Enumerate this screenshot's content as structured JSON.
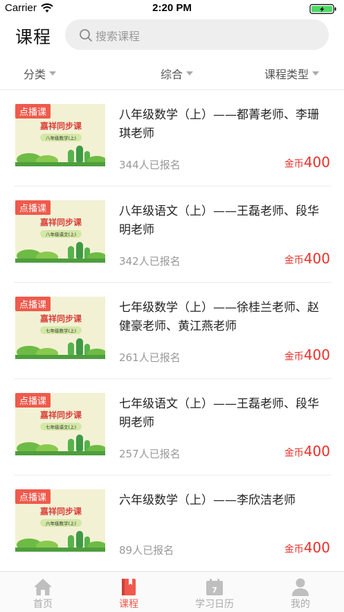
{
  "status_bar": {
    "carrier": "Carrier",
    "time": "2:20 PM"
  },
  "header": {
    "title": "课程",
    "search_placeholder": "搜索课程"
  },
  "filters": {
    "category": "分类",
    "general": "综合",
    "course_type": "课程类型"
  },
  "thumbnail": {
    "banner_text": "嘉祥同步课"
  },
  "courses": [
    {
      "badge": "点播课",
      "subject_tag": "八年级数学(上)",
      "title": "八年级数学（上）——都菁老师、李珊琪老师",
      "enrolled": "344人已报名",
      "price_unit": "金币",
      "price": "400"
    },
    {
      "badge": "点播课",
      "subject_tag": "八年级语文(上)",
      "title": "八年级语文（上）——王磊老师、段华明老师",
      "enrolled": "342人已报名",
      "price_unit": "金币",
      "price": "400"
    },
    {
      "badge": "点播课",
      "subject_tag": "七年级数学(上)",
      "title": "七年级数学（上）——徐桂兰老师、赵健豪老师、黄江燕老师",
      "enrolled": "261人已报名",
      "price_unit": "金币",
      "price": "400"
    },
    {
      "badge": "点播课",
      "subject_tag": "七年级语文(上)",
      "title": "七年级语文（上）——王磊老师、段华明老师",
      "enrolled": "257人已报名",
      "price_unit": "金币",
      "price": "400"
    },
    {
      "badge": "点播课",
      "subject_tag": "六年级数学(上)",
      "title": "六年级数学（上）——李欣洁老师",
      "enrolled": "89人已报名",
      "price_unit": "金币",
      "price": "400"
    }
  ],
  "tab_bar": {
    "home": "首页",
    "courses": "课程",
    "calendar": "学习日历",
    "calendar_day": "7",
    "profile": "我的",
    "active": "courses"
  },
  "colors": {
    "accent": "#ef5a4c",
    "price": "#e8302a",
    "thumb_bg": "#f3f1d4",
    "banner_text": "#d9413a"
  }
}
